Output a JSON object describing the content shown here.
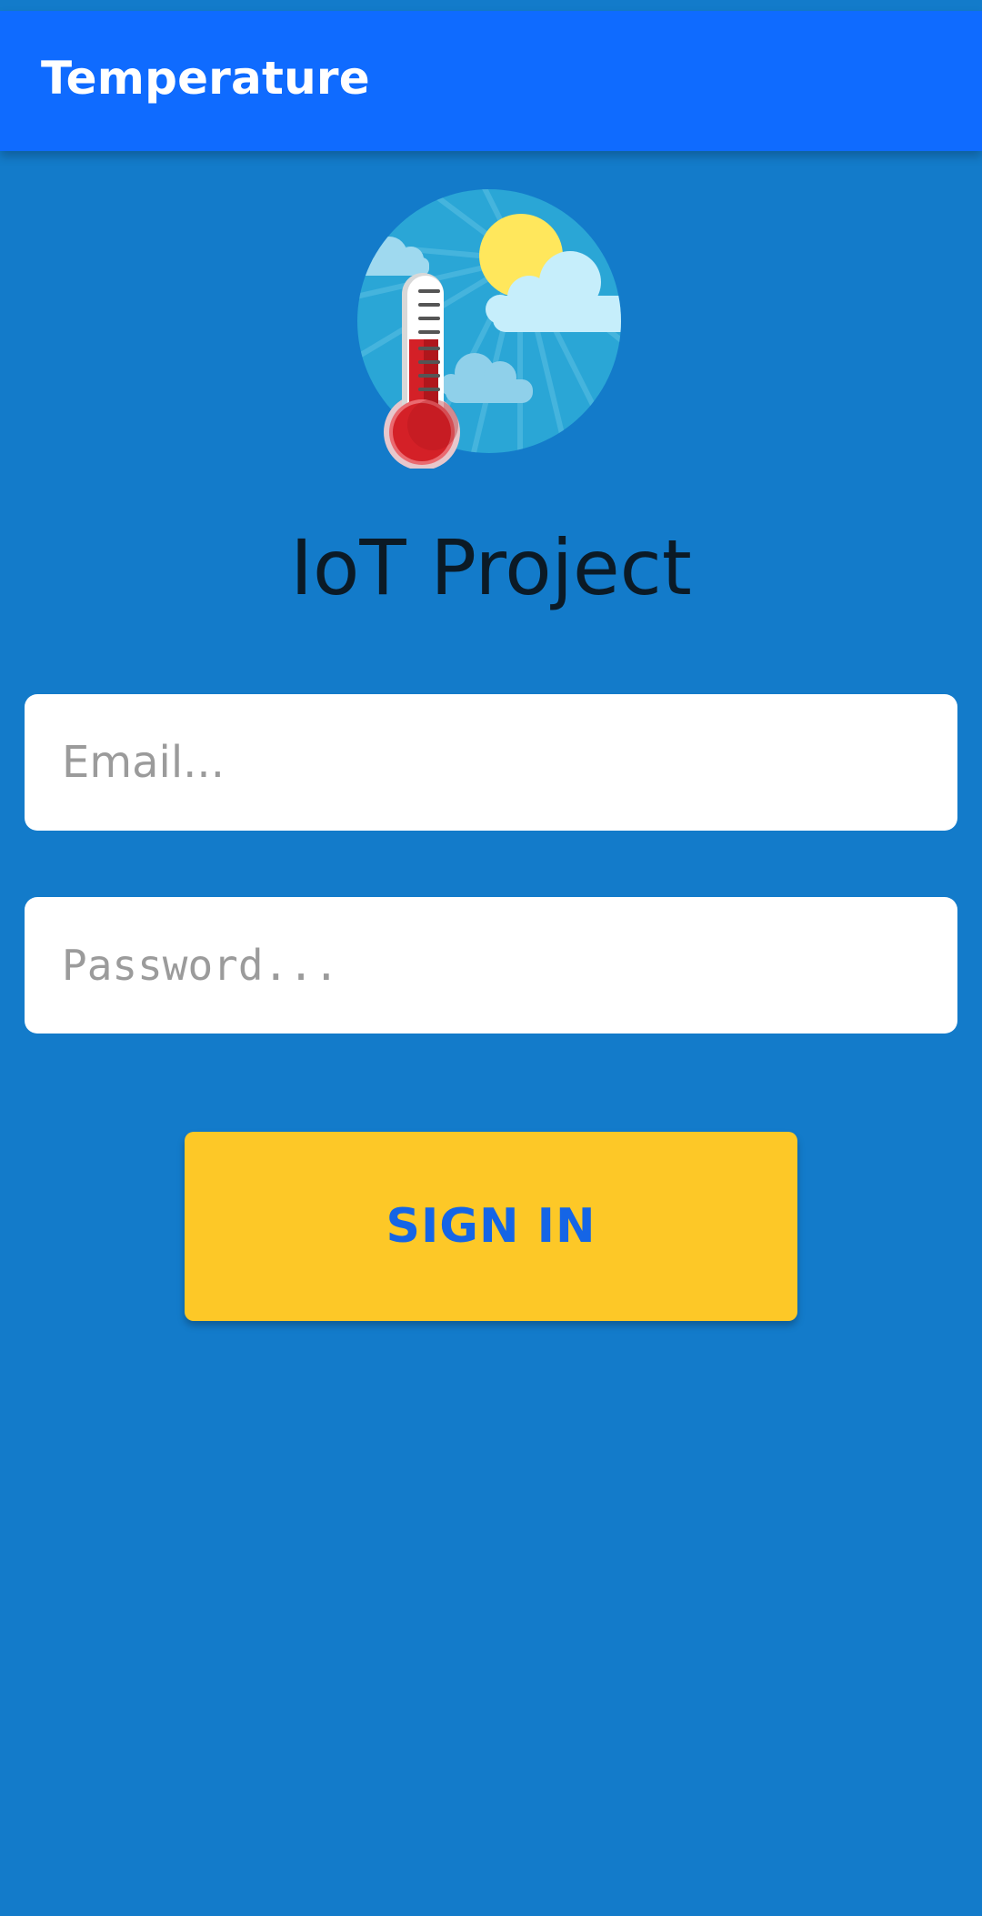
{
  "app_bar": {
    "title": "Temperature"
  },
  "logo": {
    "icon": "thermometer-weather-icon"
  },
  "main": {
    "project_title": "IoT Project"
  },
  "form": {
    "email_placeholder": "Email...",
    "email_value": "",
    "password_placeholder": "Password...",
    "password_value": "",
    "sign_in_label": "SIGN IN"
  },
  "colors": {
    "background": "#137bca",
    "app_bar": "#0f6bff",
    "button": "#fdc827",
    "button_text": "#1565e6"
  }
}
